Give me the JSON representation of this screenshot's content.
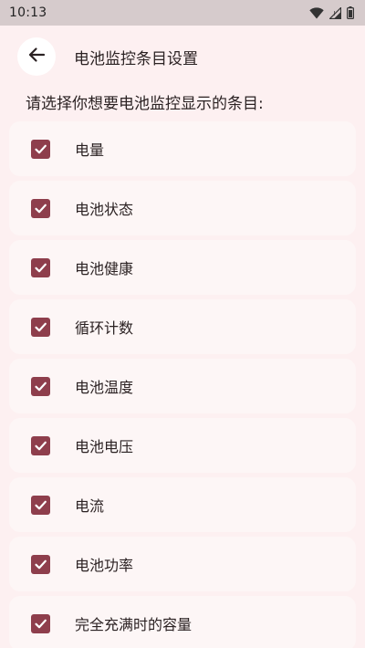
{
  "status_bar": {
    "time": "10:13",
    "icons": [
      "wifi-icon",
      "signal-icon",
      "battery-icon"
    ]
  },
  "header": {
    "back_icon": "arrow-back-icon",
    "title": "电池监控条目设置"
  },
  "instruction": "请选择你想要电池监控显示的条目:",
  "colors": {
    "background": "#fdf0f1",
    "card": "#fdf6f6",
    "checkbox": "#8e3e4c",
    "status_bar": "#d6cbcc",
    "text": "#2b2223"
  },
  "items": [
    {
      "label": "电量",
      "checked": true
    },
    {
      "label": "电池状态",
      "checked": true
    },
    {
      "label": "电池健康",
      "checked": true
    },
    {
      "label": "循环计数",
      "checked": true
    },
    {
      "label": "电池温度",
      "checked": true
    },
    {
      "label": "电池电压",
      "checked": true
    },
    {
      "label": "电流",
      "checked": true
    },
    {
      "label": "电池功率",
      "checked": true
    },
    {
      "label": "完全充满时的容量",
      "checked": true
    }
  ]
}
